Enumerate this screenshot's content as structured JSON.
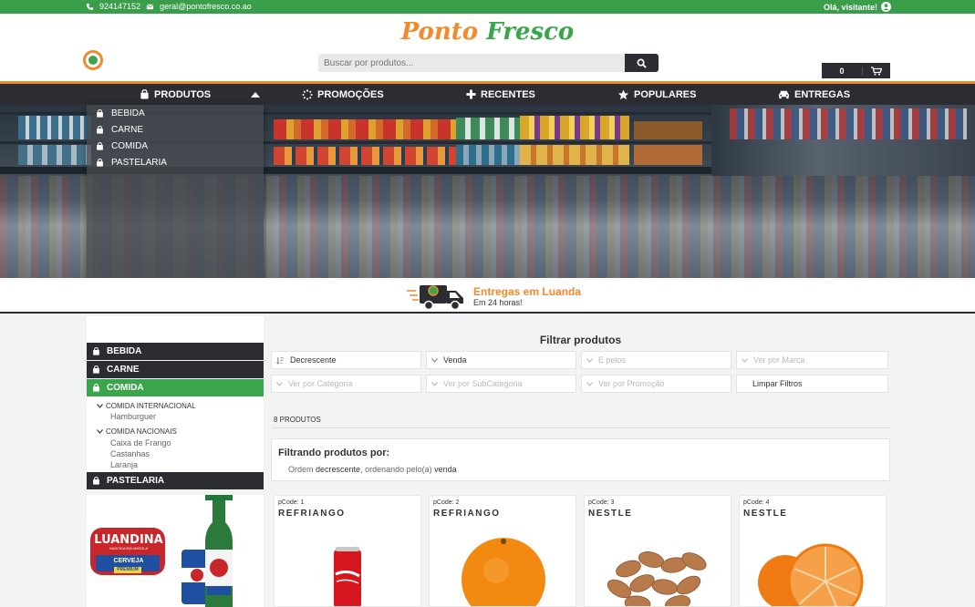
{
  "topbar": {
    "phone": "924147152",
    "email": "geral@pontofresco.co.ao",
    "greeting": "Olá, visitante!"
  },
  "logo": {
    "word1": "Ponto",
    "word2": "Fresco"
  },
  "search": {
    "placeholder": "Buscar por produtos..."
  },
  "cart": {
    "count": "0"
  },
  "nav": {
    "produtos": "PRODUTOS",
    "promocoes": "PROMOÇÕES",
    "recentes": "RECENTES",
    "populares": "POPULARES",
    "entregas": "ENTREGAS"
  },
  "dropdown": {
    "items": [
      "BEBIDA",
      "CARNE",
      "COMIDA",
      "PASTELARIA"
    ]
  },
  "delivery": {
    "title": "Entregas em Luanda",
    "subtitle": "Em 24 horas!"
  },
  "sidebar": {
    "categories": [
      "BEBIDA",
      "CARNE",
      "COMIDA",
      "PASTELARIA"
    ],
    "groups": [
      {
        "title": "COMIDA INTERNACIONAL",
        "items": [
          "Hamburguer"
        ]
      },
      {
        "title": "COMIDA NACIONAIS",
        "items": [
          "Caixa de Frango",
          "Castanhas",
          "Laranja"
        ]
      }
    ]
  },
  "banner": {
    "brand": "LUANDINA",
    "sub": "CERVEJA",
    "tag": "PREMIUM",
    "tagline": "NASCIDA EM ANGOLA"
  },
  "filters": {
    "title": "Filtrar produtos",
    "order": "Decrescente",
    "sort_by": "Venda",
    "e_pelos": "E pelos",
    "marca": "Ver por Marca",
    "categoria": "Ver por Categoria",
    "subcategoria": "Ver por SubCategoria",
    "promocao": "Ver por Promoção",
    "clear": "Limpar Filtros"
  },
  "results": {
    "count": "8 PRODUTOS",
    "summary_title": "Filtrando produtos por:",
    "summary_prefix": "Ordem",
    "summary_order": "decrescente",
    "summary_mid": ", ordenando pelo(a)",
    "summary_sort": "venda"
  },
  "products": [
    {
      "code": "pCode: 1",
      "brand": "REFRIANGO"
    },
    {
      "code": "pCode: 2",
      "brand": "REFRIANGO"
    },
    {
      "code": "pCode: 3",
      "brand": "NESTLE"
    },
    {
      "code": "pCode: 4",
      "brand": "NESTLE"
    }
  ],
  "colors": {
    "green": "#3aa54a",
    "orange": "#f08a2c",
    "dark": "#2b2d33"
  }
}
